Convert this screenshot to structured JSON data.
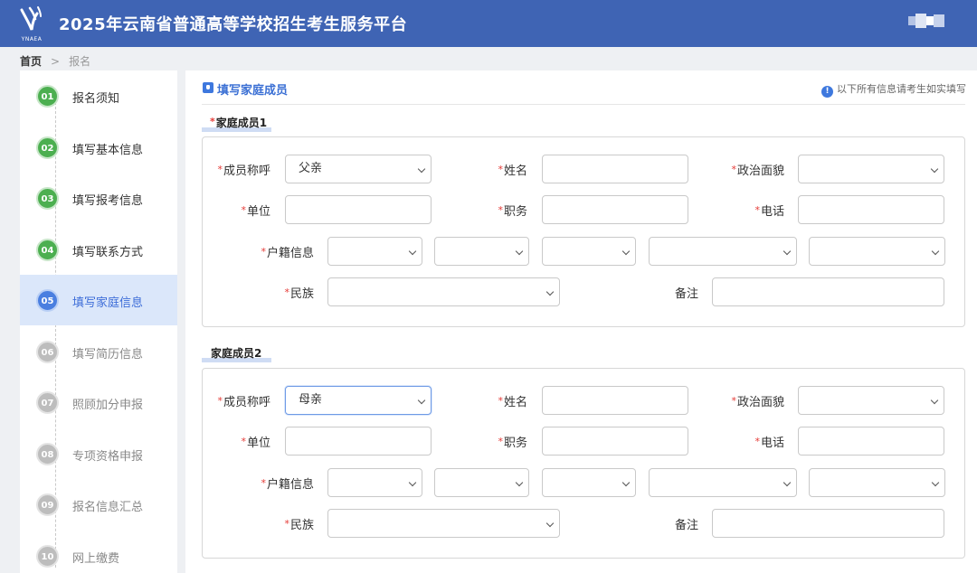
{
  "header": {
    "title": "2025年云南省普通高等学校招生考生服务平台",
    "logo_text": "YNAEA"
  },
  "breadcrumb": {
    "home": "首页",
    "separator": ">",
    "current": "报名"
  },
  "steps": [
    {
      "num": "01",
      "label": "报名须知",
      "status": "done"
    },
    {
      "num": "02",
      "label": "填写基本信息",
      "status": "done"
    },
    {
      "num": "03",
      "label": "填写报考信息",
      "status": "done"
    },
    {
      "num": "04",
      "label": "填写联系方式",
      "status": "done"
    },
    {
      "num": "05",
      "label": "填写家庭信息",
      "status": "active"
    },
    {
      "num": "06",
      "label": "填写简历信息",
      "status": "todo"
    },
    {
      "num": "07",
      "label": "照顾加分申报",
      "status": "todo"
    },
    {
      "num": "08",
      "label": "专项资格申报",
      "status": "todo"
    },
    {
      "num": "09",
      "label": "报名信息汇总",
      "status": "todo"
    },
    {
      "num": "10",
      "label": "网上缴费",
      "status": "todo"
    }
  ],
  "section": {
    "title": "填写家庭成员",
    "notice": "以下所有信息请考生如实填写",
    "info_icon": "!"
  },
  "labels": {
    "relation": "成员称呼",
    "name": "姓名",
    "political": "政治面貌",
    "unit": "单位",
    "position": "职务",
    "phone": "电话",
    "household": "户籍信息",
    "ethnicity": "民族",
    "remark": "备注",
    "required_mark": "*"
  },
  "members": [
    {
      "title": "家庭成员1",
      "title_required": true,
      "relation": "父亲",
      "name": "",
      "political": "",
      "unit": "",
      "position": "",
      "phone": "",
      "household": [
        "",
        "",
        "",
        "",
        ""
      ],
      "ethnicity": "",
      "remark": ""
    },
    {
      "title": "家庭成员2",
      "title_required": false,
      "relation": "母亲",
      "name": "",
      "political": "",
      "unit": "",
      "position": "",
      "phone": "",
      "household": [
        "",
        "",
        "",
        "",
        ""
      ],
      "ethnicity": "",
      "remark": ""
    }
  ],
  "colors": {
    "header": "#3f64b4",
    "accent": "#3e78de",
    "done": "#4caf50",
    "active_bg": "#dbe7fa",
    "required": "#e53935"
  }
}
